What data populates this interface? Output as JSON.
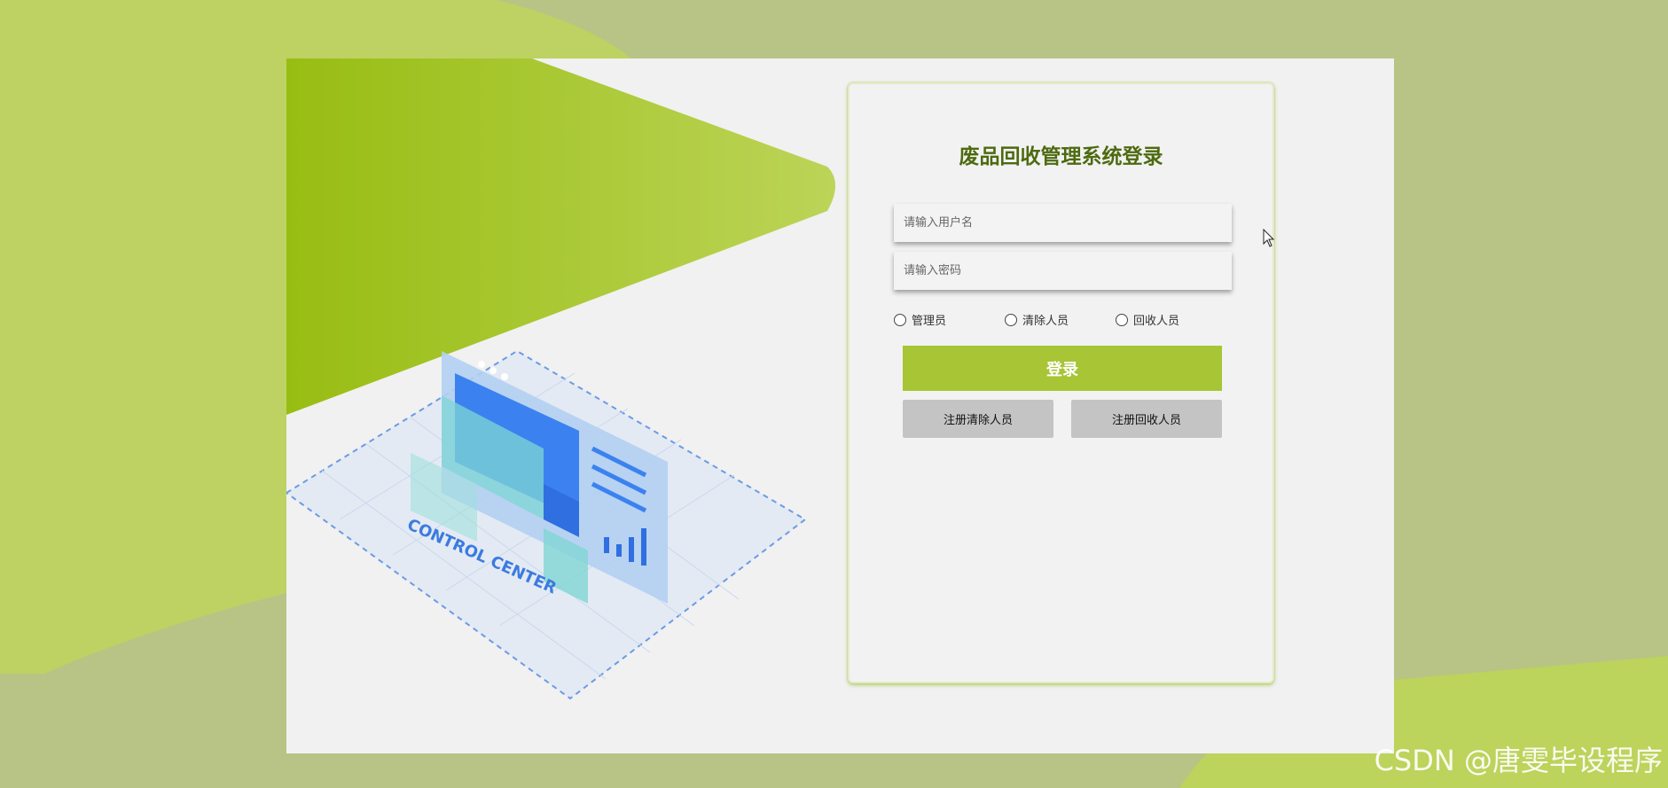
{
  "login": {
    "title": "废品回收管理系统登录",
    "username_placeholder": "请输入用户名",
    "password_placeholder": "请输入密码",
    "roles": [
      "管理员",
      "清除人员",
      "回收人员"
    ],
    "login_button": "登录",
    "register_clean_button": "注册清除人员",
    "register_recycle_button": "注册回收人员"
  },
  "illustration": {
    "caption": "CONTROL CENTER"
  },
  "watermark": "CSDN @唐雯毕设程序",
  "colors": {
    "accent_green": "#a7c535",
    "dark_green_title": "#4d6a0f",
    "background_olive": "#b8c485",
    "panel_bg": "#f2f2f2",
    "register_gray": "#c4c4c4"
  }
}
